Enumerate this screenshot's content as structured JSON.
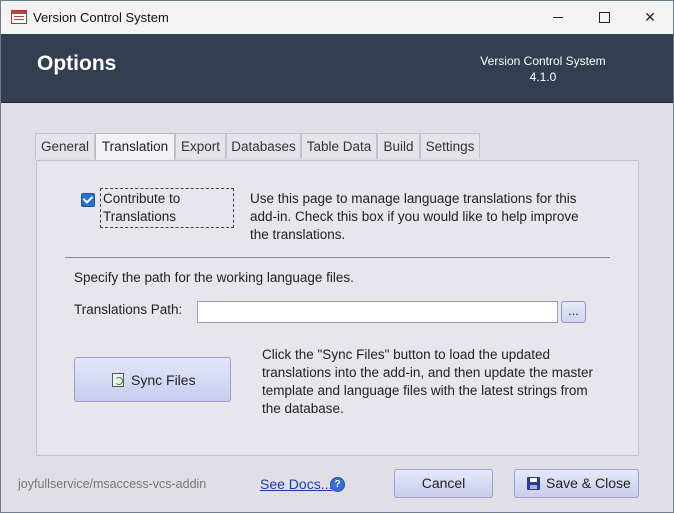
{
  "window": {
    "title": "Version Control System"
  },
  "header": {
    "title": "Options",
    "app_name": "Version Control System",
    "version": "4.1.0"
  },
  "tabs": [
    {
      "label": "General"
    },
    {
      "label": "Translation",
      "active": true
    },
    {
      "label": "Export"
    },
    {
      "label": "Databases"
    },
    {
      "label": "Table Data"
    },
    {
      "label": "Build"
    },
    {
      "label": "Settings"
    }
  ],
  "translation": {
    "contribute_checked": true,
    "contribute_label": "Contribute to Translations",
    "description": "Use this page to manage language translations for this add-in. Check this box if you would like to help improve the translations.",
    "specify_text": "Specify the path for the working language files.",
    "path_label": "Translations Path:",
    "path_value": "",
    "browse_label": "...",
    "sync_label": "Sync Files",
    "sync_description": "Click the \"Sync Files\" button to load the updated translations into the add-in, and then update the master template and language files with the latest strings from the database."
  },
  "footer": {
    "repo": "joyfullservice/msaccess-vcs-addin",
    "docs_link": "See Docs...",
    "help_icon": "?",
    "cancel_label": "Cancel",
    "save_label": "Save & Close"
  },
  "icons": {
    "app": "access-form-icon",
    "sync": "sync-document-icon",
    "save": "floppy-disk-icon",
    "help": "help-circle-icon"
  },
  "colors": {
    "header_bg": "#333f50",
    "accent_checkbox": "#2a6ed1",
    "link": "#1a3bb0"
  }
}
